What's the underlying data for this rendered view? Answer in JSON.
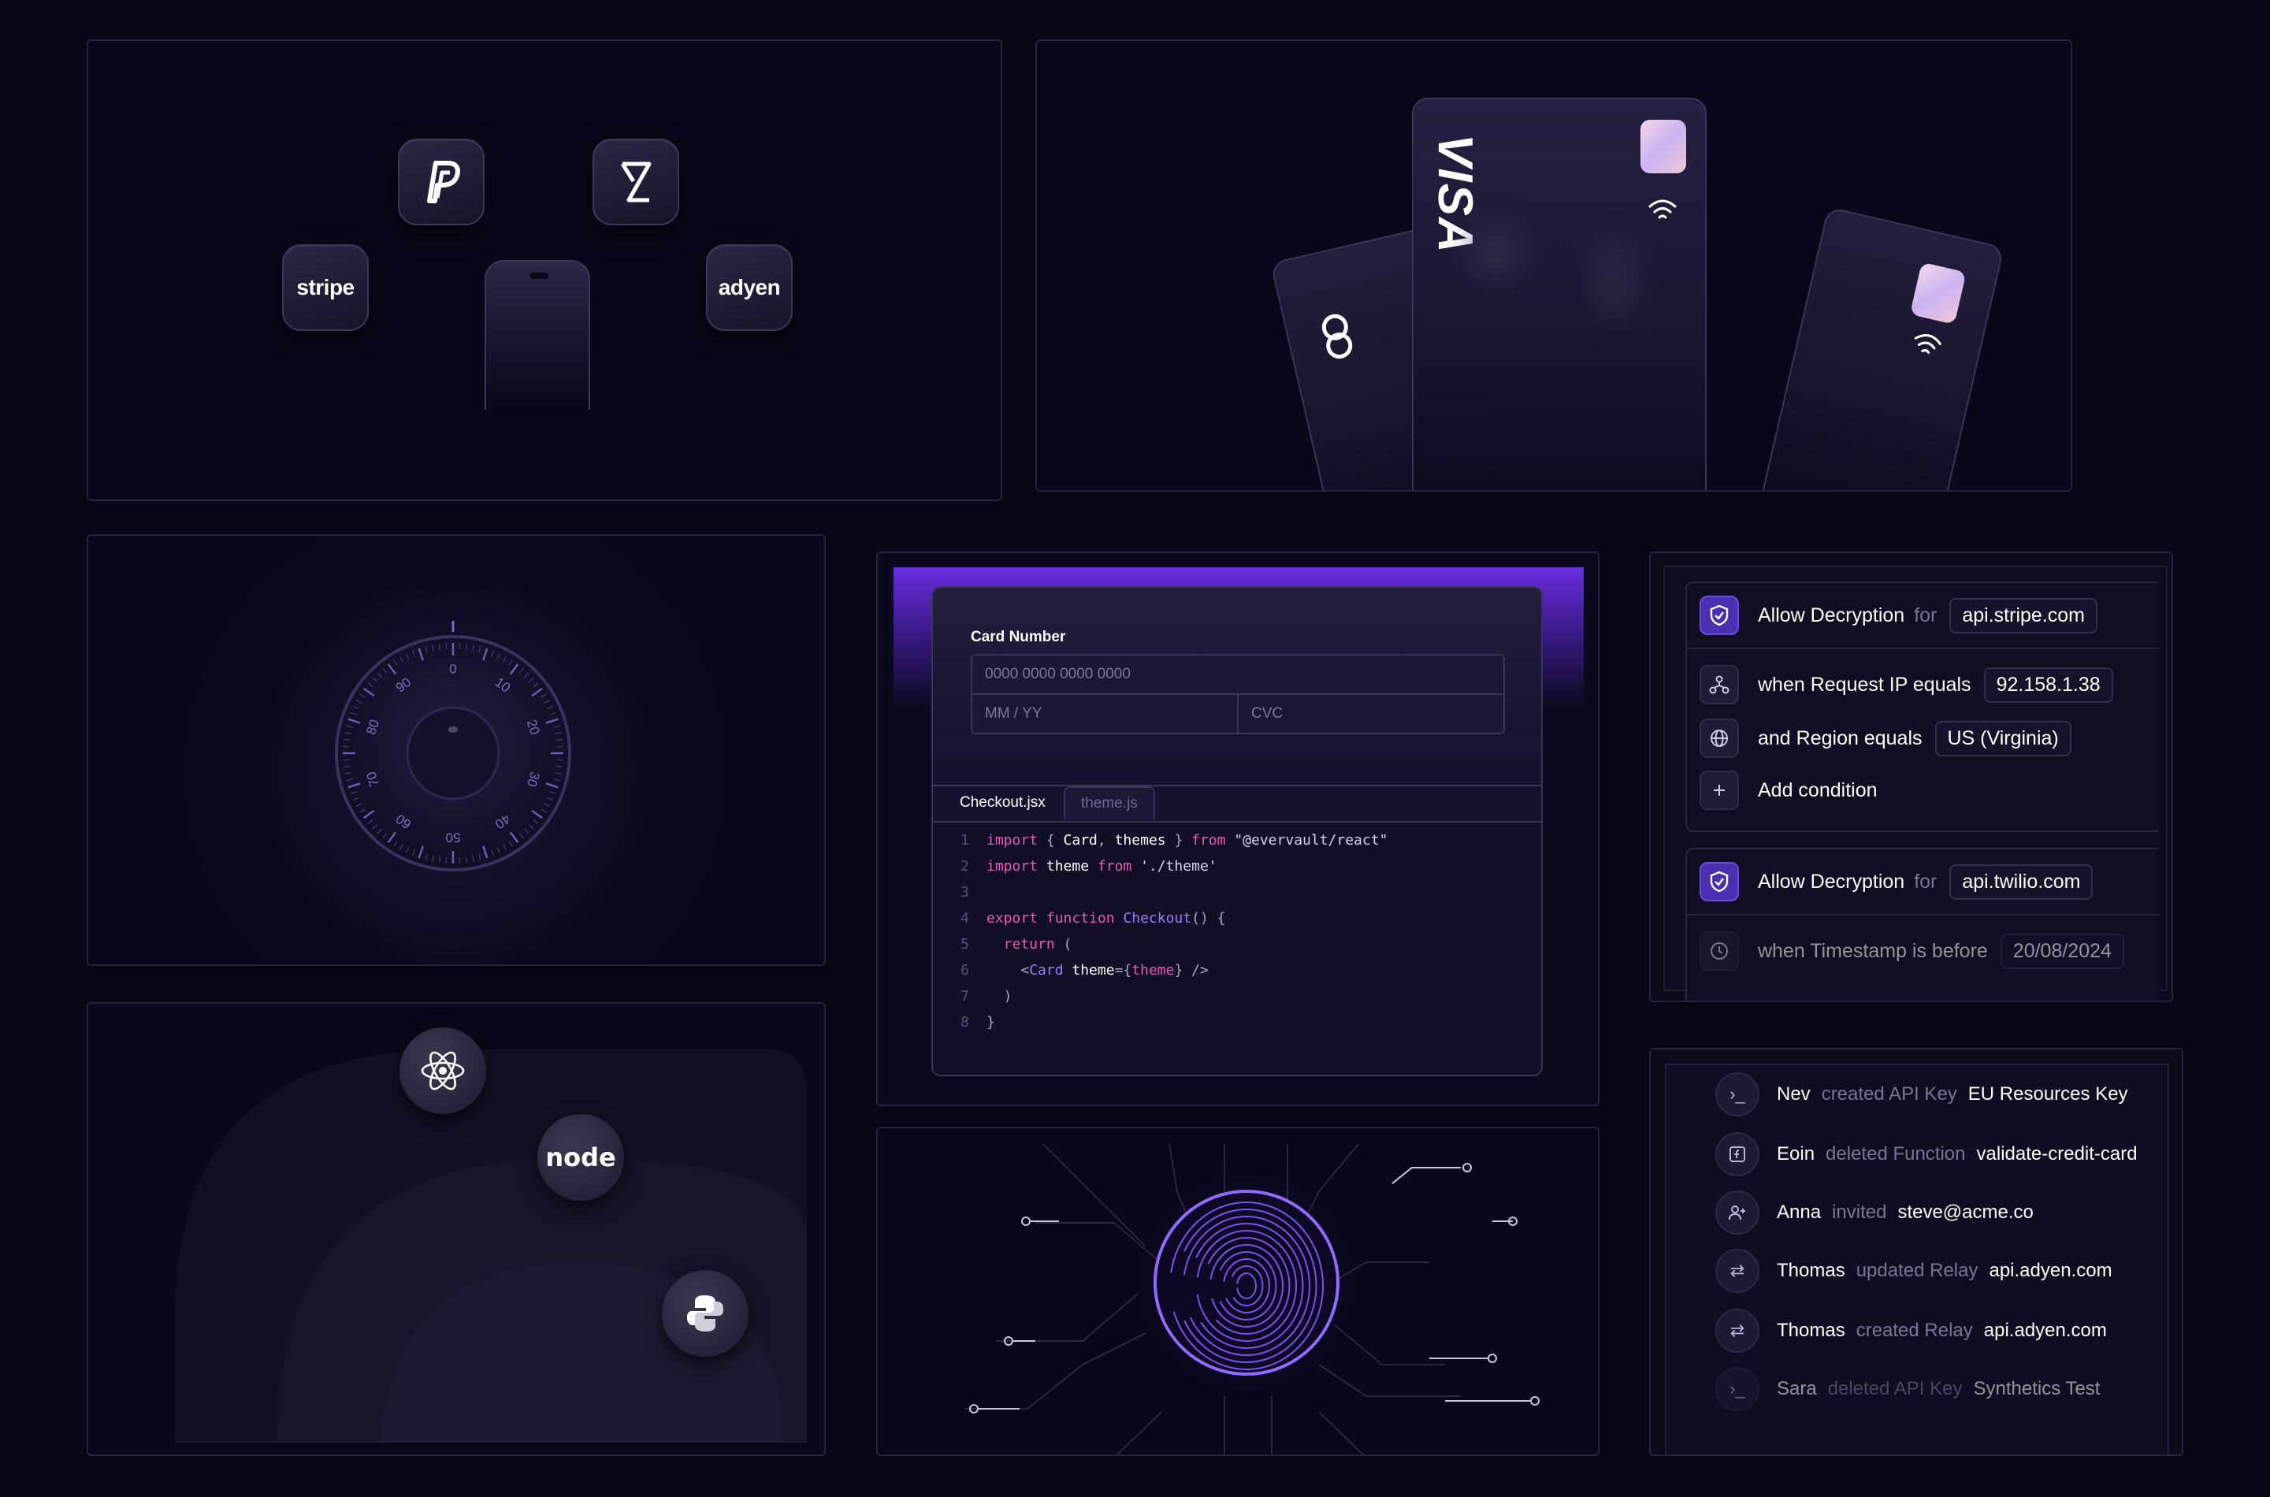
{
  "integrations": {
    "brands": [
      {
        "name": "paypal",
        "label": ""
      },
      {
        "name": "checkout",
        "label": ""
      },
      {
        "name": "stripe",
        "label": "stripe"
      },
      {
        "name": "adyen",
        "label": "adyen"
      }
    ]
  },
  "cards": {
    "visa_label": "VISA"
  },
  "dial": {
    "ticks": [
      "0",
      "10",
      "20",
      "30",
      "40",
      "50",
      "60",
      "70",
      "80",
      "90"
    ]
  },
  "checkout": {
    "card_number_label": "Card Number",
    "card_number_placeholder": "0000 0000 0000 0000",
    "expiry_placeholder": "MM / YY",
    "cvc_placeholder": "CVC",
    "tabs": [
      "Checkout.jsx",
      "theme.js"
    ],
    "code_lines": [
      {
        "n": "1",
        "parts": [
          [
            "kw",
            "import"
          ],
          [
            "pl",
            " { "
          ],
          [
            "id",
            "Card"
          ],
          [
            "pl",
            ", "
          ],
          [
            "id",
            "themes"
          ],
          [
            "pl",
            " } "
          ],
          [
            "kw",
            "from"
          ],
          [
            "str",
            " \"@evervault/react\""
          ]
        ]
      },
      {
        "n": "2",
        "parts": [
          [
            "kw",
            "import"
          ],
          [
            "id",
            " theme "
          ],
          [
            "kw",
            "from"
          ],
          [
            "str",
            " './theme'"
          ]
        ]
      },
      {
        "n": "3",
        "parts": []
      },
      {
        "n": "4",
        "parts": [
          [
            "kw",
            "export"
          ],
          [
            "kw",
            " function"
          ],
          [
            "fn",
            " Checkout"
          ],
          [
            "pl",
            "() {"
          ]
        ]
      },
      {
        "n": "5",
        "parts": [
          [
            "kw",
            "  return"
          ],
          [
            "pl",
            " ("
          ]
        ]
      },
      {
        "n": "6",
        "parts": [
          [
            "pl",
            "    <"
          ],
          [
            "fn",
            "Card"
          ],
          [
            "id",
            " theme"
          ],
          [
            "pl",
            "={"
          ],
          [
            "kw",
            "theme"
          ],
          [
            "pl",
            "} />"
          ]
        ]
      },
      {
        "n": "7",
        "parts": [
          [
            "pl",
            "  )"
          ]
        ]
      },
      {
        "n": "8",
        "parts": [
          [
            "pl",
            "}"
          ]
        ]
      }
    ]
  },
  "policy": {
    "blocks": [
      {
        "rows": [
          {
            "icon": "shield-icon",
            "text": "Allow Decryption",
            "joiner": "for",
            "chip": "api.stripe.com"
          },
          {
            "icon": "network-icon",
            "text": "when Request IP equals",
            "joiner": "",
            "chip": "92.158.1.38"
          },
          {
            "icon": "globe-icon",
            "text": "and Region equals",
            "joiner": "",
            "chip": "US (Virginia)"
          },
          {
            "icon": "plus-icon",
            "text": "Add condition",
            "joiner": "",
            "chip": ""
          }
        ]
      },
      {
        "rows": [
          {
            "icon": "shield-icon",
            "text": "Allow Decryption",
            "joiner": "for",
            "chip": "api.twilio.com"
          },
          {
            "icon": "clock-icon",
            "text": "when Timestamp is before",
            "joiner": "",
            "chip": "20/08/2024"
          }
        ]
      }
    ]
  },
  "languages": [
    {
      "name": "react",
      "label": ""
    },
    {
      "name": "node",
      "label": "node"
    },
    {
      "name": "python",
      "label": ""
    }
  ],
  "activity": {
    "items": [
      {
        "icon": "terminal-icon",
        "user": "Nev",
        "action": "created API Key",
        "target": "EU Resources Key"
      },
      {
        "icon": "function-icon",
        "user": "Eoin",
        "action": "deleted Function",
        "target": "validate-credit-card"
      },
      {
        "icon": "user-plus-icon",
        "user": "Anna",
        "action": "invited",
        "target": "steve@acme.co"
      },
      {
        "icon": "relay-icon",
        "user": "Thomas",
        "action": "updated Relay",
        "target": "api.adyen.com"
      },
      {
        "icon": "relay-icon",
        "user": "Thomas",
        "action": "created Relay",
        "target": "api.adyen.com"
      },
      {
        "icon": "terminal-icon",
        "user": "Sara",
        "action": "deleted API Key",
        "target": "Synthetics Test"
      }
    ]
  }
}
